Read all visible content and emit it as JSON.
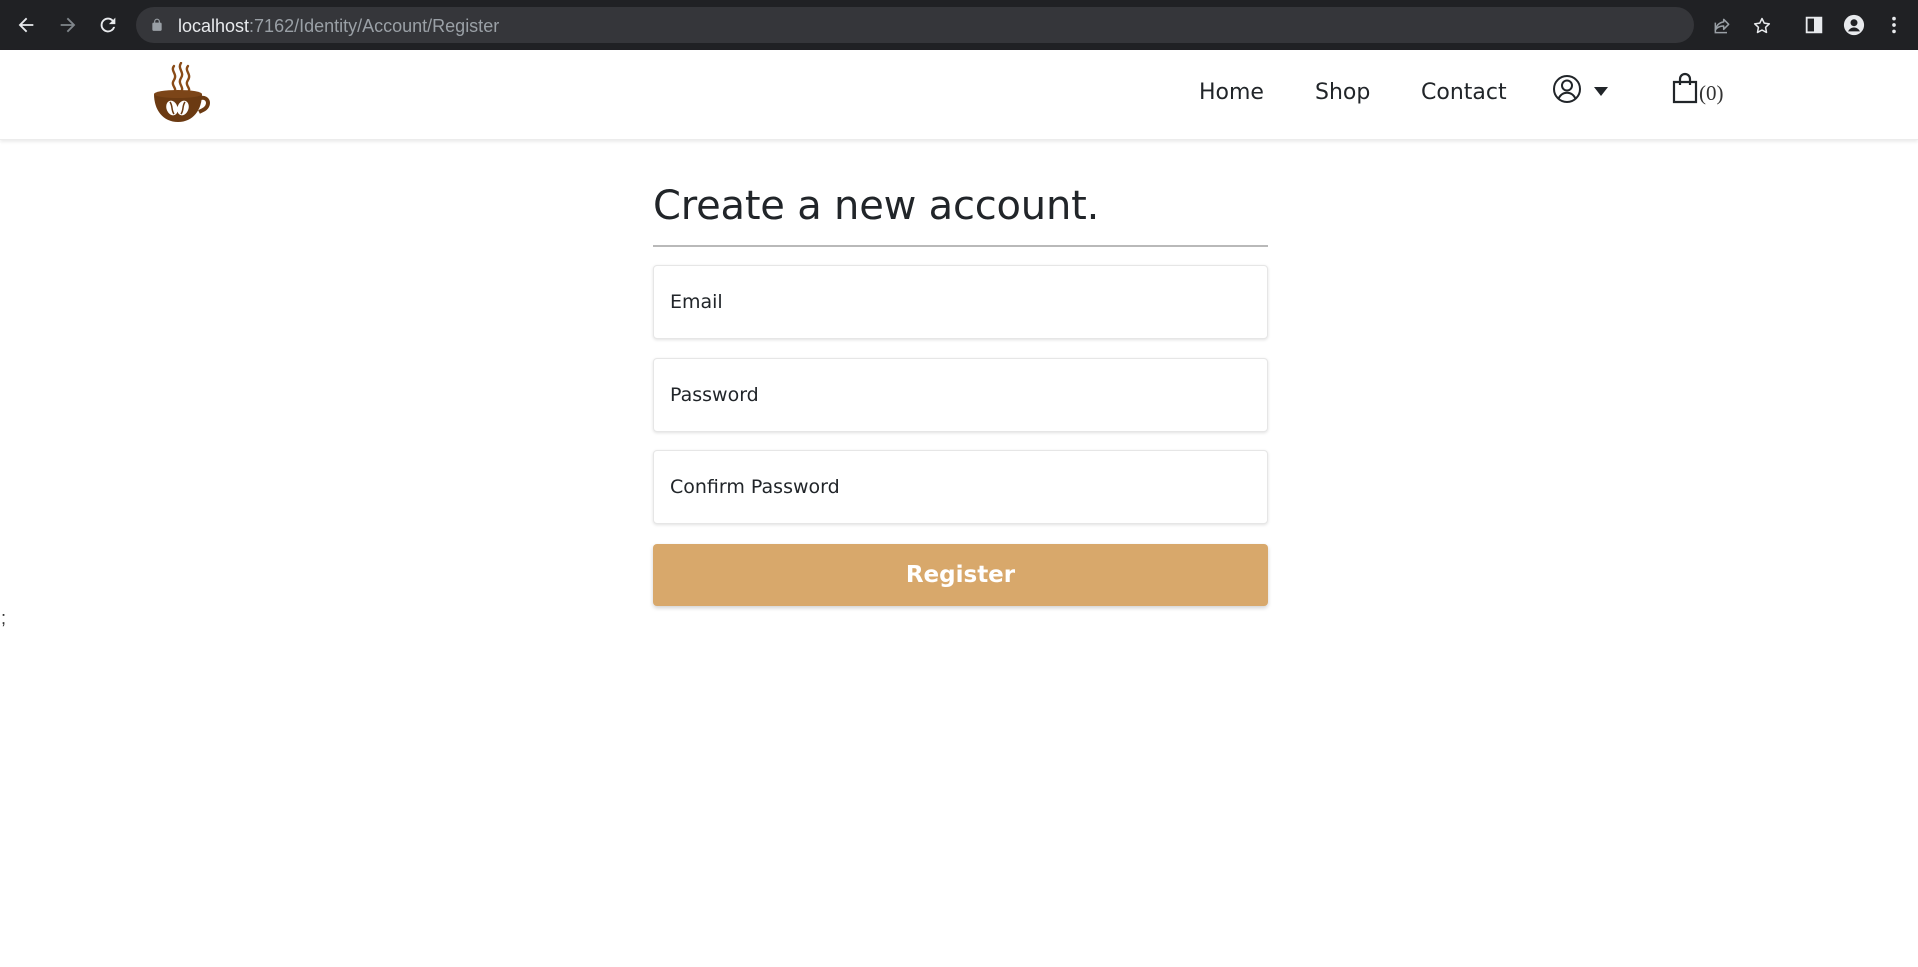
{
  "browser": {
    "url_host": "localhost",
    "url_path": ":7162/Identity/Account/Register"
  },
  "header": {
    "logo_icon": "coffee-cup-logo",
    "nav": {
      "home": "Home",
      "shop": "Shop",
      "contact": "Contact"
    },
    "user_icon": "user-circle-icon",
    "cart": {
      "icon": "shopping-bag-icon",
      "count_text": "(0)"
    }
  },
  "form": {
    "title": "Create a new account.",
    "email_placeholder": "Email",
    "password_placeholder": "Password",
    "confirm_placeholder": "Confirm Password",
    "register_label": "Register"
  },
  "stray_text": ";",
  "colors": {
    "accent": "#d8a86b",
    "logo_brown": "#6b3a12",
    "chrome_bg": "#202124"
  }
}
